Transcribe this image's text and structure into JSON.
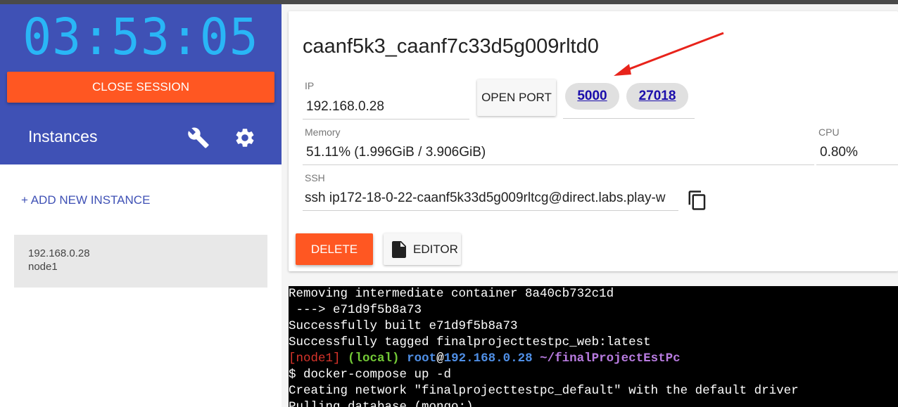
{
  "session": {
    "timer": "03:53:05",
    "close_label": "CLOSE SESSION",
    "instances_label": "Instances",
    "add_instance_label": "+ ADD NEW INSTANCE"
  },
  "instances": [
    {
      "ip": "192.168.0.28",
      "name": "node1"
    }
  ],
  "details": {
    "title": "caanf5k3_caanf7c33d5g009rltd0",
    "ip_label": "IP",
    "ip_value": "192.168.0.28",
    "open_port_label": "OPEN PORT",
    "ports": [
      "5000",
      "27018"
    ],
    "memory_label": "Memory",
    "memory_value": "51.11% (1.996GiB / 3.906GiB)",
    "cpu_label": "CPU",
    "cpu_value": "0.80%",
    "ssh_label": "SSH",
    "ssh_value": "ssh ip172-18-0-22-caanf5k33d5g009rltcg@direct.labs.play-w",
    "delete_label": "DELETE",
    "editor_label": "EDITOR"
  },
  "terminal": {
    "lines": [
      "Removing intermediate container 8a40cb732c1d",
      " ---> e71d9f5b8a73",
      "Successfully built e71d9f5b8a73",
      "Successfully tagged finalprojecttestpc_web:latest"
    ],
    "prompt": {
      "node": "[node1]",
      "local": "(local)",
      "user": "root",
      "at": "@",
      "host": "192.168.0.28",
      "path": "~/finalProjectEstPc"
    },
    "command": "$ docker-compose up -d",
    "after": [
      "Creating network \"finalprojecttestpc_default\" with the default driver",
      "Pulling database (mongo:)..."
    ]
  },
  "colors": {
    "sidebar_head": "#3f51b5",
    "timer": "#29b6f6",
    "accent_button": "#ff5722",
    "link": "#1a0dab",
    "annotation_arrow": "#e8231b"
  }
}
